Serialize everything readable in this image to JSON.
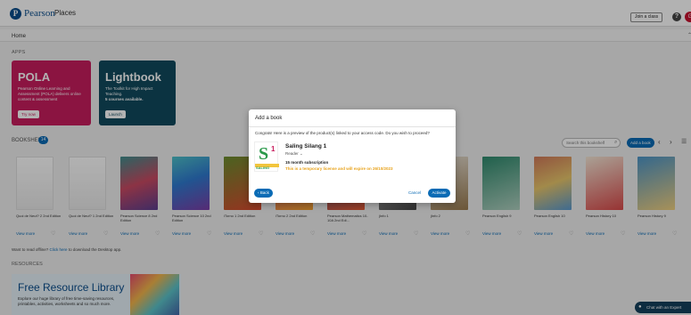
{
  "header": {
    "logo_text": "Pearson",
    "app_name": "Places",
    "join_class": "Join a class",
    "help_icon": "?",
    "avatar_initial": "G"
  },
  "nav": {
    "home": "Home"
  },
  "apps": {
    "section_label": "APPS",
    "pola": {
      "title": "POLA",
      "description": "Pearson Online Learning and Assessment (POLA) delivers online content & assessment",
      "button": "Try now"
    },
    "lightbook": {
      "title": "Lightbook",
      "description": "The Toolkit for High Impact Teaching.",
      "courses": "5 courses available.",
      "button": "Launch"
    }
  },
  "bookshelf": {
    "label": "BOOKSHELF",
    "count": "14",
    "search_placeholder": "Search this bookshelf",
    "add_book": "Add a book",
    "books": [
      {
        "title": "Quoi de Neuf? 2 2nd Edition",
        "view": "View more"
      },
      {
        "title": "Quoi de Neuf? 1 2nd Edition",
        "view": "View more"
      },
      {
        "title": "Pearson Science 8 2nd Edition",
        "view": "View more"
      },
      {
        "title": "Pearson Science 10 2nd Edition",
        "view": "View more"
      },
      {
        "title": "iTorno 1 2nd Edition",
        "view": "View more"
      },
      {
        "title": "iTorno 2 2nd Edition",
        "view": "View more"
      },
      {
        "title": "Pearson Mathematics 10-10A 2nd Edi...",
        "view": "View more"
      },
      {
        "title": "jInfo 1",
        "view": "View more"
      },
      {
        "title": "jInfo 2",
        "view": "View more"
      },
      {
        "title": "Pearson English 9",
        "view": "View more"
      },
      {
        "title": "Pearson English 10",
        "view": "View more"
      },
      {
        "title": "Pearson History 10",
        "view": "View more"
      },
      {
        "title": "Pearson History 9",
        "view": "View more"
      }
    ],
    "offline_prefix": "Want to read offline?",
    "offline_link": "Click here",
    "offline_suffix": "to download the Desktop app."
  },
  "resources": {
    "label": "RESOURCES",
    "title": "Free Resource Library",
    "description": "Explore our huge library of free time-saving resources, printables, activities, worksheets and so much more."
  },
  "chat": {
    "label": "Chat with an Expert"
  },
  "modal": {
    "title": "Add a book",
    "message": "Congrats! Here is a preview of the product(s) linked to your access code. Do you wish to proceed?",
    "product_title": "Saling Silang 1",
    "product_type": "Reader",
    "cover_letter": "S",
    "cover_number": "1",
    "cover_word": "SALING",
    "subscription": "15 month subscription",
    "warning": "This is a temporary license and will expire on 26/10/2023",
    "back": "Back",
    "cancel": "Cancel",
    "activate": "Activate"
  },
  "colors": {
    "brand": "#0a4d8c",
    "accent": "#0a6bb5",
    "pola": "#c81e5e",
    "lightbook": "#104a5e",
    "warning": "#e8a21a"
  }
}
